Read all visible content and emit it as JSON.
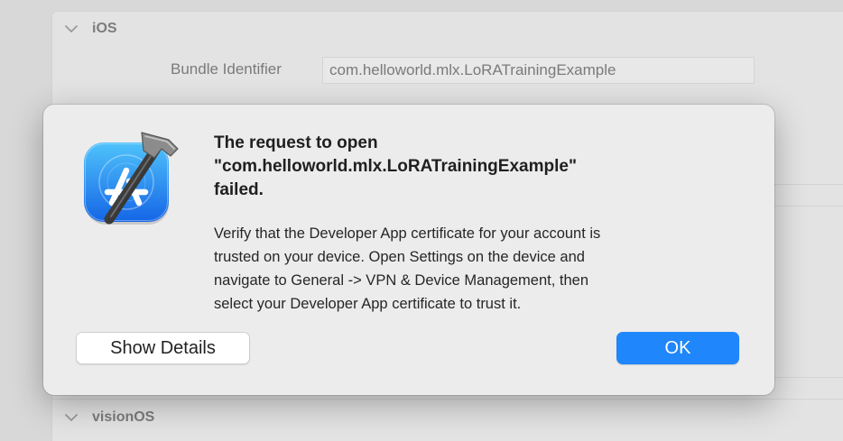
{
  "background": {
    "sections": {
      "ios": "iOS",
      "visionos": "visionOS"
    },
    "bundle": {
      "label": "Bundle Identifier",
      "value": "com.helloworld.mlx.LoRATrainingExample"
    }
  },
  "alert": {
    "icon": "xcode-app-icon",
    "title": "The request to open\n\"com.helloworld.mlx.LoRATrainingExample\"\nfailed.",
    "message": "Verify that the Developer App certificate for your account is\ntrusted on your device. Open Settings on the device and\nnavigate to General -> VPN & Device Management, then\nselect your Developer App certificate to trust it.",
    "buttons": {
      "details": "Show Details",
      "ok": "OK"
    }
  },
  "colors": {
    "accent": "#1f86fb",
    "dialog_bg": "#ececec",
    "backdrop": "#d8d8d8"
  }
}
